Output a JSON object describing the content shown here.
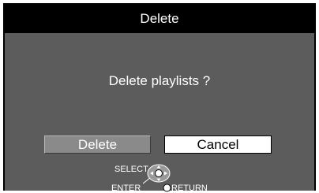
{
  "dialog": {
    "title": "Delete",
    "message": "Delete playlists ?",
    "buttons": {
      "delete_label": "Delete",
      "cancel_label": "Cancel",
      "focused": "Delete"
    }
  },
  "hints": {
    "select_label": "SELECT",
    "enter_label": "ENTER",
    "return_label": "RETURN",
    "nav_icon": "directional-pad-icon",
    "return_icon": "return-circle-icon"
  },
  "colors": {
    "title_bg": "#000000",
    "dialog_bg": "#5c5c5c",
    "focused_button_bg": "#8a8a8a",
    "unfocused_button_bg": "#ffffff",
    "text": "#ffffff"
  }
}
